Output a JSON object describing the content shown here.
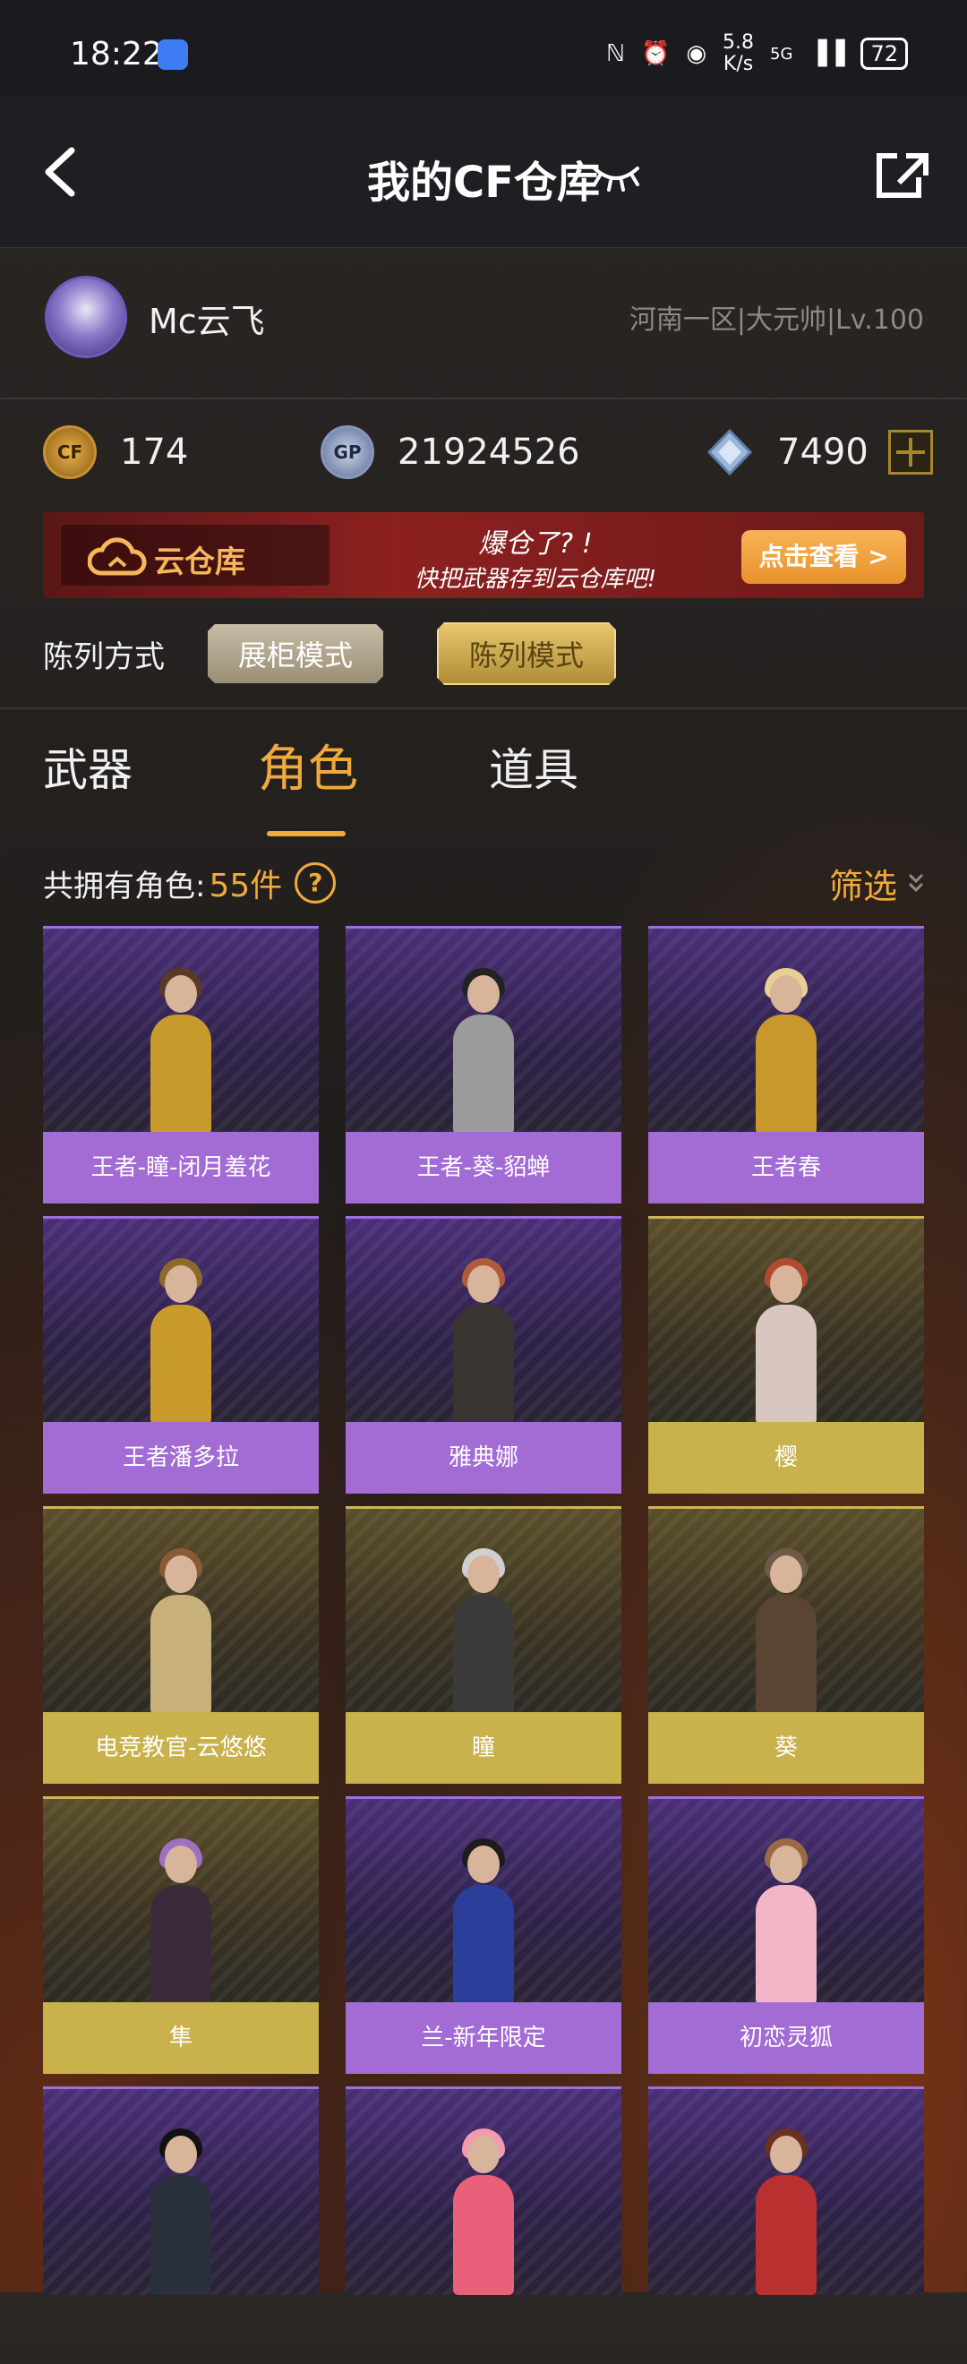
{
  "status_bar": {
    "time": "18:22",
    "speed_value": "5.8",
    "speed_unit": "K/s",
    "network": "5G",
    "battery": "72"
  },
  "header": {
    "title": "我的CF仓库"
  },
  "profile": {
    "username": "Mc云飞",
    "server_info": "河南一区|大元帅|Lv.100"
  },
  "currencies": [
    {
      "icon": "cf-coin-icon",
      "label": "CF",
      "value": "174"
    },
    {
      "icon": "gp-coin-icon",
      "label": "GP",
      "value": "21924526"
    },
    {
      "icon": "diamond-icon",
      "value": "7490"
    }
  ],
  "banner": {
    "cloud_label": "云仓库",
    "slogan_line1": "爆仓了? !",
    "slogan_line2": "快把武器存到云仓库吧!",
    "button_label": "点击查看 >"
  },
  "layout": {
    "label": "陈列方式",
    "modes": [
      "展柜模式",
      "陈列模式"
    ],
    "selected": "陈列模式"
  },
  "tabs": [
    {
      "label": "武器",
      "active": false
    },
    {
      "label": "角色",
      "active": true
    },
    {
      "label": "道具",
      "active": false
    }
  ],
  "summary": {
    "count_label": "共拥有角色:",
    "count_value": "55件",
    "help": "?",
    "filter_label": "筛选"
  },
  "colors": {
    "accent": "#f0a93c",
    "purple_tier": "#a36bd4",
    "gold_tier": "#c9b14c"
  },
  "characters": [
    {
      "name": "王者-瞳-闭月羞花",
      "tier": "purple",
      "outfit": "#c79a2e",
      "hair": "#5a3a24"
    },
    {
      "name": "王者-葵-貂蝉",
      "tier": "purple",
      "outfit": "#9b9b9b",
      "hair": "#222222"
    },
    {
      "name": "王者春",
      "tier": "purple",
      "outfit": "#c8982c",
      "hair": "#e7cf95"
    },
    {
      "name": "王者潘多拉",
      "tier": "purple",
      "outfit": "#c99a2c",
      "hair": "#8c6a2a"
    },
    {
      "name": "雅典娜",
      "tier": "purple",
      "outfit": "#3a3430",
      "hair": "#b25a3c"
    },
    {
      "name": "樱",
      "tier": "gold",
      "outfit": "#d8c7c0",
      "hair": "#b24a32"
    },
    {
      "name": "电竞教官-云悠悠",
      "tier": "gold",
      "outfit": "#c8b07a",
      "hair": "#8a5a36"
    },
    {
      "name": "瞳",
      "tier": "gold",
      "outfit": "#3a3a3a",
      "hair": "#cfcfcf"
    },
    {
      "name": "葵",
      "tier": "gold",
      "outfit": "#5a4434",
      "hair": "#6d5a48"
    },
    {
      "name": "隼",
      "tier": "gold",
      "outfit": "#3a2a3a",
      "hair": "#a070c0"
    },
    {
      "name": "兰-新年限定",
      "tier": "purple",
      "outfit": "#2b3e9a",
      "hair": "#1c1c1c"
    },
    {
      "name": "初恋灵狐",
      "tier": "purple",
      "outfit": "#f2b6c7",
      "hair": "#9a6a48"
    },
    {
      "name": "",
      "tier": "purple",
      "outfit": "#2a2f3c",
      "hair": "#111111"
    },
    {
      "name": "",
      "tier": "purple",
      "outfit": "#e8607a",
      "hair": "#f29ab2"
    },
    {
      "name": "",
      "tier": "purple",
      "outfit": "#b83030",
      "hair": "#6a3020"
    }
  ]
}
